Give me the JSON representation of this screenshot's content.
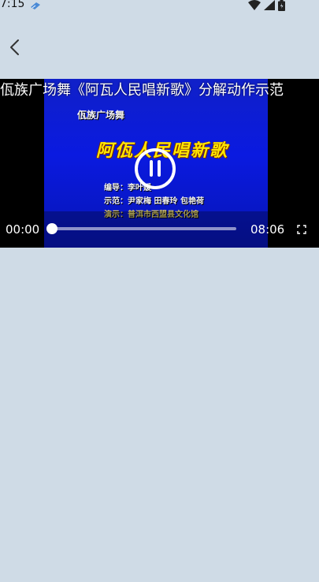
{
  "status_bar": {
    "time": "7:15",
    "icons": [
      "app-notification-icon",
      "wifi-icon",
      "signal-icon",
      "battery-icon"
    ]
  },
  "nav": {
    "back_icon": "chevron-left-icon"
  },
  "player": {
    "title": "佤族广场舞《阿瓦人民唱新歌》分解动作示范",
    "current_time": "00:00",
    "total_time": "08:06",
    "progress": 0,
    "state_icon": "pause-icon",
    "fullscreen_icon": "fullscreen-icon",
    "frame": {
      "top_label": "佤族广场舞",
      "song_title": "阿佤人民唱新歌",
      "credit_line_1": "编导：李叶媛",
      "credit_line_2": "示范：尹家梅  田春玲  包艳荷",
      "credit_line_3": "演示：普洱市西盟县文化馆"
    }
  },
  "colors": {
    "page_background": "#cfdbe6",
    "video_background": "#0a1ae0",
    "song_title_color": "#ffe600"
  }
}
